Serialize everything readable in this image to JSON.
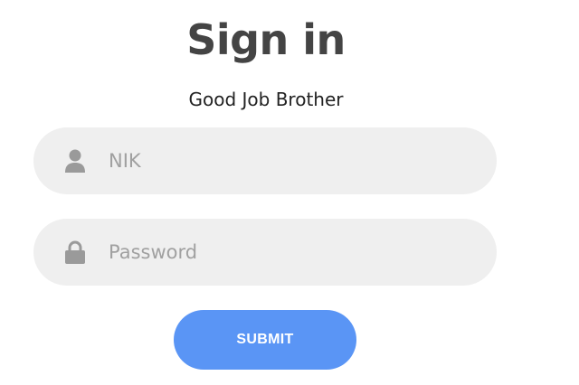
{
  "form": {
    "title": "Sign in",
    "subtitle": "Good Job Brother",
    "nik_field": {
      "placeholder": "NIK",
      "value": "",
      "icon": "user-icon"
    },
    "password_field": {
      "placeholder": "Password",
      "value": "",
      "icon": "lock-icon"
    },
    "submit_label": "SUBMIT"
  },
  "colors": {
    "title": "#444444",
    "field_background": "#efefef",
    "icon": "#9a9a9a",
    "placeholder": "#a0a0a0",
    "submit_background": "#5a95f5",
    "submit_text": "#ffffff"
  }
}
